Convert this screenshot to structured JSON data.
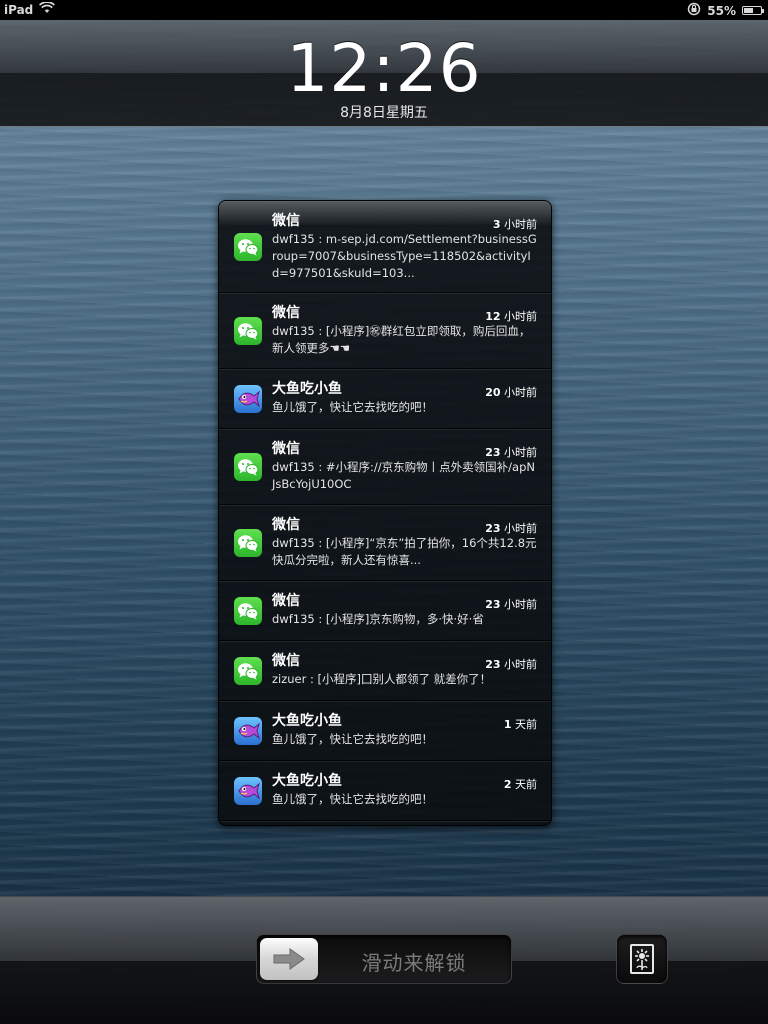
{
  "status_bar": {
    "device": "iPad",
    "battery_percent": "55%",
    "battery_level": 0.55,
    "icons": [
      "wifi-icon",
      "rotation-lock-icon",
      "battery-icon"
    ]
  },
  "lock_screen": {
    "time": "12:26",
    "date": "8月8日星期五"
  },
  "notifications": [
    {
      "app": "微信",
      "icon": "wechat-icon",
      "time_num": "3",
      "time_unit": " 小时前",
      "body": "dwf135 : m-sep.jd.com/Settlement?businessGroup=7007&businessType=118502&activityId=977501&skuId=103..."
    },
    {
      "app": "微信",
      "icon": "wechat-icon",
      "time_num": "12",
      "time_unit": " 小时前",
      "body": "dwf135 : [小程序]㊗群红包立即领取，购后回血，新人领更多☚☚"
    },
    {
      "app": "大鱼吃小鱼",
      "icon": "fish-icon",
      "time_num": "20",
      "time_unit": " 小时前",
      "body": "鱼儿饿了，快让它去找吃的吧！"
    },
    {
      "app": "微信",
      "icon": "wechat-icon",
      "time_num": "23",
      "time_unit": " 小时前",
      "body": "dwf135 : #小程序://京东购物丨点外卖领国补/apNJsBcYojU10OC"
    },
    {
      "app": "微信",
      "icon": "wechat-icon",
      "time_num": "23",
      "time_unit": " 小时前",
      "body": "dwf135 : [小程序]“京东”拍了拍你，16个共12.8元快瓜分完啦，新人还有惊喜..."
    },
    {
      "app": "微信",
      "icon": "wechat-icon",
      "time_num": "23",
      "time_unit": " 小时前",
      "body": "dwf135 : [小程序]京东购物，多·快·好·省"
    },
    {
      "app": "微信",
      "icon": "wechat-icon",
      "time_num": "23",
      "time_unit": " 小时前",
      "body": "zizuer : [小程序]囗别人都领了 就差你了！"
    },
    {
      "app": "大鱼吃小鱼",
      "icon": "fish-icon",
      "time_num": "1",
      "time_unit": " 天前",
      "body": "鱼儿饿了，快让它去找吃的吧！"
    },
    {
      "app": "大鱼吃小鱼",
      "icon": "fish-icon",
      "time_num": "2",
      "time_unit": " 天前",
      "body": "鱼儿饿了，快让它去找吃的吧！"
    }
  ],
  "unlock": {
    "label": "滑动来解锁",
    "knob_icon": "arrow-right-icon",
    "camera_icon": "photo-frame-icon"
  },
  "colors": {
    "wechat_green": "#2db52b",
    "fish_blue": "#2b6fd1",
    "panel_bg": "#0a0c0f"
  }
}
